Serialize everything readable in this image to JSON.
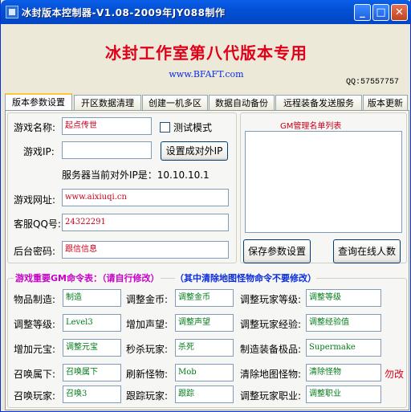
{
  "window": {
    "title": "冰封版本控制器-V1.08-2009年JY088制作"
  },
  "banner": {
    "title": "冰封工作室第八代版本专用",
    "url": "www.BFAFT.com",
    "qq": "QQ:57557757"
  },
  "tabs": [
    {
      "label": "版本参数设置"
    },
    {
      "label": "开区数据清理"
    },
    {
      "label": "创建一机多区"
    },
    {
      "label": "数据自动备份"
    },
    {
      "label": "远程装备发送服务"
    },
    {
      "label": "版本更新"
    }
  ],
  "settings": {
    "game_name_label": "游戏名称:",
    "game_name_value": "起点传世",
    "test_mode_label": "测试模式",
    "game_ip_label": "游戏IP:",
    "game_ip_value": "",
    "set_external_ip_button": "设置成对外IP",
    "server_ip_text": "服务器当前对外IP是：10.10.10.1",
    "website_label": "游戏网址:",
    "website_value": "www.aixiuqi.cn",
    "qq_label": "客服QQ号:",
    "qq_value": "24322291",
    "backend_pw_label": "后台密码:",
    "backend_pw_value": "跟信信息",
    "gm_list_title": "GM管理名单列表",
    "save_button": "保存参数设置",
    "online_button": "查询在线人数"
  },
  "commands": {
    "title_left": "游戏重要GM命令表：（请自行修改）",
    "title_right": "（其中清除地图怪物命令不要修改）",
    "warn": "勿改",
    "rows": [
      [
        {
          "label": "物品制造:",
          "value": "制造"
        },
        {
          "label": "调整金币:",
          "value": "调整金币"
        },
        {
          "label": "调整玩家等级:",
          "value": "调整等级"
        }
      ],
      [
        {
          "label": "调整等级:",
          "value": "Level3"
        },
        {
          "label": "增加声望:",
          "value": "调整声望"
        },
        {
          "label": "调整玩家经验:",
          "value": "调整经验值"
        }
      ],
      [
        {
          "label": "增加元宝:",
          "value": "调整元宝"
        },
        {
          "label": "秒杀玩家:",
          "value": "杀死"
        },
        {
          "label": "制造装备极品:",
          "value": "Supermake"
        }
      ],
      [
        {
          "label": "召唤属下:",
          "value": "召唤属下"
        },
        {
          "label": "刷新怪物:",
          "value": "Mob"
        },
        {
          "label": "清除地图怪物:",
          "value": "清除怪物"
        }
      ],
      [
        {
          "label": "召唤玩家:",
          "value": "召唤3"
        },
        {
          "label": "跟踪玩家:",
          "value": "跟踪"
        },
        {
          "label": "调整玩家职业:",
          "value": "调整职业"
        }
      ]
    ]
  }
}
